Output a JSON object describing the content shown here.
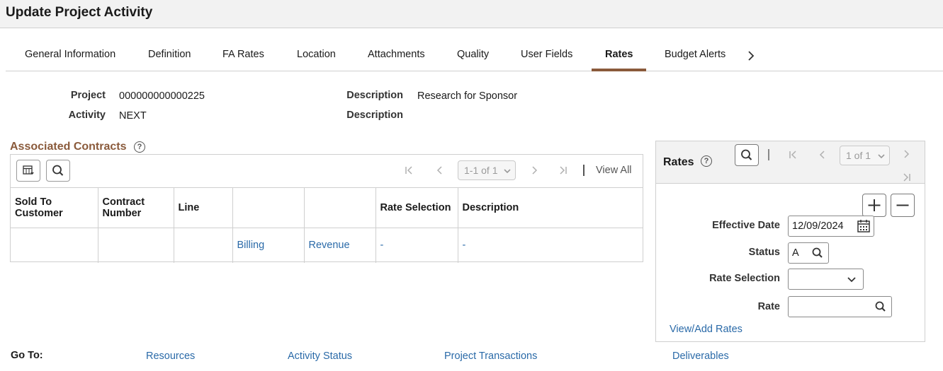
{
  "page": {
    "title": "Update Project Activity"
  },
  "tabs": [
    {
      "label": "General Information"
    },
    {
      "label": "Definition"
    },
    {
      "label": "FA Rates"
    },
    {
      "label": "Location"
    },
    {
      "label": "Attachments"
    },
    {
      "label": "Quality"
    },
    {
      "label": "User Fields"
    },
    {
      "label": "Rates"
    },
    {
      "label": "Budget Alerts"
    }
  ],
  "header_fields": {
    "project_label": "Project",
    "project_value": "000000000000225",
    "activity_label": "Activity",
    "activity_value": "NEXT",
    "description_label": "Description",
    "description_value": "Research for Sponsor",
    "description2_label": "Description",
    "description2_value": ""
  },
  "associated_contracts": {
    "title": "Associated Contracts",
    "help": "?",
    "pager": {
      "range": "1-1 of 1",
      "view_all": "View All"
    },
    "columns": [
      "Sold To Customer",
      "Contract Number",
      "Line",
      "",
      "",
      "Rate Selection",
      "Description"
    ],
    "rows": [
      {
        "sold_to": "",
        "contract": "",
        "line": "",
        "billing": "Billing",
        "revenue": "Revenue",
        "rate_selection": "-",
        "description": "-"
      }
    ]
  },
  "rates": {
    "title": "Rates",
    "help": "?",
    "pager": {
      "range": "1 of 1"
    },
    "effective_date_label": "Effective Date",
    "effective_date_value": "12/09/2024",
    "status_label": "Status",
    "status_value": "A",
    "rate_selection_label": "Rate Selection",
    "rate_selection_value": "",
    "rate_label": "Rate",
    "rate_value": "",
    "view_add_link": "View/Add Rates"
  },
  "goto": {
    "label": "Go To:",
    "links": [
      "Resources",
      "Activity Status",
      "Project Transactions",
      "Deliverables"
    ]
  },
  "colors": {
    "accent": "#8a5a3b",
    "link": "#2a6aa8"
  }
}
